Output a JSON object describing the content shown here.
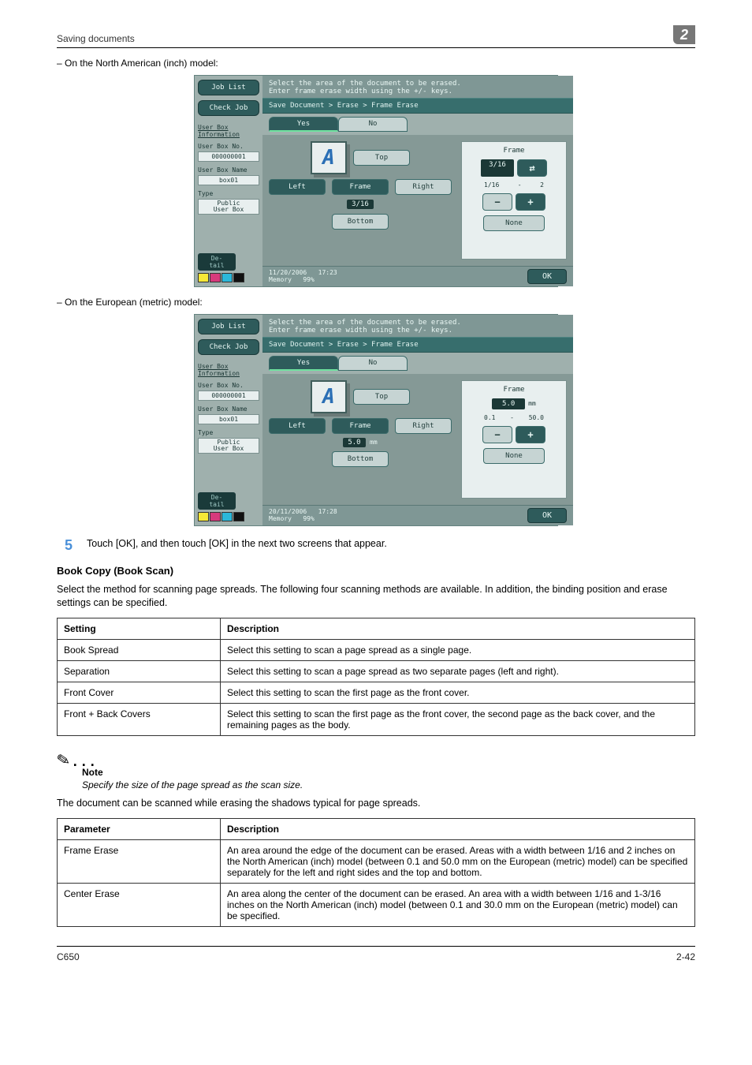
{
  "header": {
    "section": "Saving documents",
    "chapter": "2"
  },
  "bullets": {
    "na": "On the North American (inch) model:",
    "eu": "On the European (metric) model:"
  },
  "screen": {
    "job_list": "Job List",
    "check_job": "Check Job",
    "userbox_info": "User Box\nInformation",
    "userbox_no_label": "User Box No.",
    "userbox_no": "000000001",
    "userbox_name_label": "User Box Name",
    "userbox_name": "box01",
    "type_label": "Type",
    "type_value": "Public\nUser Box",
    "detail": "De-\ntail",
    "instr": "Select the area of the document to be erased.\nEnter frame erase width using the +/- keys.",
    "crumb": "Save Document > Erase > Frame Erase",
    "tab_yes": "Yes",
    "tab_no": "No",
    "top": "Top",
    "left": "Left",
    "frame": "Frame",
    "right": "Right",
    "bottom": "Bottom",
    "side_title": "Frame",
    "side_reset_icon": "⇄",
    "none": "None",
    "ok": "OK",
    "na": {
      "width_val": "3/16",
      "side_val": "3/16",
      "range_min": "1/16",
      "range_max": "2",
      "date": "11/20/2006",
      "time": "17:23",
      "mem_label": "Memory",
      "mem_val": "99%"
    },
    "eu": {
      "width_val": "5.0",
      "width_unit": "mm",
      "side_val": "5.0",
      "side_unit": "mm",
      "range_min": "0.1",
      "range_max": "50.0",
      "date": "20/11/2006",
      "time": "17:28",
      "mem_label": "Memory",
      "mem_val": "99%"
    }
  },
  "step5": {
    "num": "5",
    "text": "Touch [OK], and then touch [OK] in the next two screens that appear."
  },
  "bookcopy": {
    "title": "Book Copy (Book Scan)",
    "intro": "Select the method for scanning page spreads. The following four scanning methods are available. In addition, the binding position and erase settings can be specified."
  },
  "table1": {
    "h1": "Setting",
    "h2": "Description",
    "rows": [
      {
        "c1": "Book Spread",
        "c2": "Select this setting to scan a page spread as a single page."
      },
      {
        "c1": "Separation",
        "c2": "Select this setting to scan a page spread as two separate pages (left and right)."
      },
      {
        "c1": "Front Cover",
        "c2": "Select this setting to scan the first page as the front cover."
      },
      {
        "c1": "Front + Back Covers",
        "c2": "Select this setting to scan the first page as the front cover, the second page as the back cover, and the remaining pages as the body."
      }
    ]
  },
  "note": {
    "label": "Note",
    "text": "Specify the size of the page spread as the scan size."
  },
  "para_after_note": "The document can be scanned while erasing the shadows typical for page spreads.",
  "table2": {
    "h1": "Parameter",
    "h2": "Description",
    "rows": [
      {
        "c1": "Frame Erase",
        "c2": "An area around the edge of the document can be erased. Areas with a width between 1/16 and 2 inches on the North American (inch) model (between 0.1 and 50.0 mm on the European (metric) model) can be specified separately for the left and right sides and the top and bottom."
      },
      {
        "c1": "Center Erase",
        "c2": "An area along the center of the document can be erased. An area with a width between 1/16 and 1-3/16 inches on the North American (inch) model (between 0.1 and 30.0 mm on the European (metric) model) can be specified."
      }
    ]
  },
  "footer": {
    "left": "C650",
    "right": "2-42"
  }
}
